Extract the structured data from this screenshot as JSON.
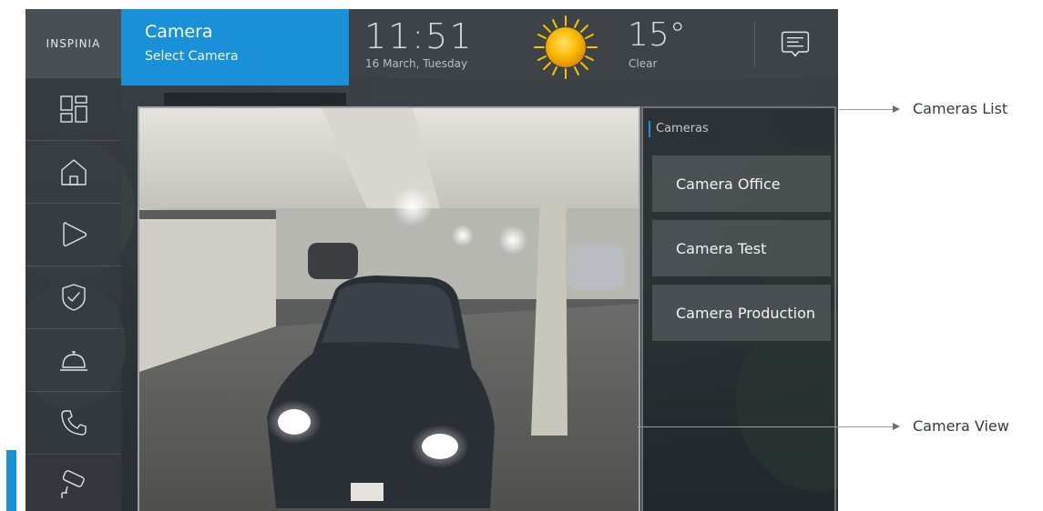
{
  "brand": {
    "logo_text": "INSPINIA"
  },
  "header": {
    "title": "Camera",
    "subtitle": "Select Camera",
    "time": "11:51",
    "date": "16 March, Tuesday",
    "temperature": "15°",
    "weather": "Clear",
    "weather_icon": "sun-icon",
    "messages_icon": "message-icon"
  },
  "sidebar": {
    "items": [
      {
        "icon": "dashboard-icon"
      },
      {
        "icon": "home-icon"
      },
      {
        "icon": "play-icon"
      },
      {
        "icon": "shield-check-icon"
      },
      {
        "icon": "service-bell-icon"
      },
      {
        "icon": "phone-icon"
      },
      {
        "icon": "camera-icon",
        "active": true
      }
    ]
  },
  "cameras": {
    "title": "Cameras",
    "items": [
      "Camera Office",
      "Camera Test",
      "Camera Production"
    ]
  },
  "annotations": {
    "cameras_list": "Cameras List",
    "camera_view": "Camera View"
  },
  "colors": {
    "accent": "#1a90d9",
    "header_bg": "#3e4348",
    "sun": "#f7b500"
  }
}
